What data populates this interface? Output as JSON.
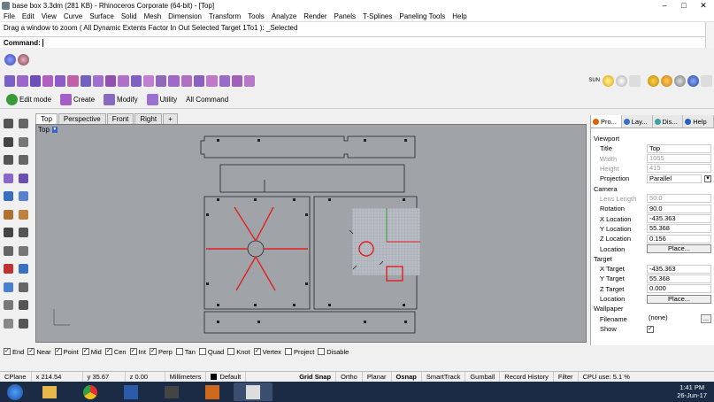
{
  "titlebar": {
    "title": "base box 3.3dm (281 KB) - Rhinoceros Corporate (64-bit) - [Top]",
    "min": "–",
    "max": "□",
    "close": "✕"
  },
  "menubar": [
    "File",
    "Edit",
    "View",
    "Curve",
    "Surface",
    "Solid",
    "Mesh",
    "Dimension",
    "Transform",
    "Tools",
    "Analyze",
    "Render",
    "Panels",
    "T-Splines",
    "Paneling Tools",
    "Help"
  ],
  "command": {
    "history": "Drag a window to zoom ( All  Dynamic  Extents  Factor  In  Out  Selected  Target  1To1 ): _Selected",
    "prompt": "Command:"
  },
  "toolbar_tabs": {
    "edit_mode": "Edit mode",
    "create": "Create",
    "modify": "Modify",
    "utility": "Utility",
    "all_command": "All Command"
  },
  "sun_label": "SUN",
  "viewport_tabs": [
    "Top",
    "Perspective",
    "Front",
    "Right"
  ],
  "viewport_add": "+",
  "viewport": {
    "label": "Top",
    "dropdown": "▼"
  },
  "osnaps": [
    {
      "label": "End",
      "checked": true
    },
    {
      "label": "Near",
      "checked": true
    },
    {
      "label": "Point",
      "checked": true
    },
    {
      "label": "Mid",
      "checked": true
    },
    {
      "label": "Cen",
      "checked": true
    },
    {
      "label": "Int",
      "checked": true
    },
    {
      "label": "Perp",
      "checked": true
    },
    {
      "label": "Tan",
      "checked": false
    },
    {
      "label": "Quad",
      "checked": false
    },
    {
      "label": "Knot",
      "checked": false
    },
    {
      "label": "Vertex",
      "checked": true
    },
    {
      "label": "Project",
      "checked": false
    },
    {
      "label": "Disable",
      "checked": false
    }
  ],
  "status": {
    "cplane": "CPlane",
    "x": "x 214.54",
    "y": "y 35.67",
    "z": "z 0.00",
    "units": "Millimeters",
    "layer": "Default",
    "grid_snap": "Grid Snap",
    "ortho": "Ortho",
    "planar": "Planar",
    "osnap": "Osnap",
    "smarttrack": "SmartTrack",
    "gumball": "Gumball",
    "record_history": "Record History",
    "filter": "Filter",
    "cpu": "CPU use: 5.1 %"
  },
  "panel": {
    "tabs": [
      "Pro...",
      "Lay...",
      "Dis...",
      "Help"
    ],
    "sections": {
      "viewport": {
        "heading": "Viewport",
        "rows": [
          {
            "k": "Title",
            "v": "Top",
            "dis": false
          },
          {
            "k": "Width",
            "v": "1055",
            "dis": true
          },
          {
            "k": "Height",
            "v": "415",
            "dis": true
          },
          {
            "k": "Projection",
            "v": "Parallel",
            "dis": false
          }
        ]
      },
      "camera": {
        "heading": "Camera",
        "rows": [
          {
            "k": "Lens Length",
            "v": "50.0",
            "dis": true
          },
          {
            "k": "Rotation",
            "v": "90.0",
            "dis": false
          },
          {
            "k": "X Location",
            "v": "-435.363",
            "dis": false
          },
          {
            "k": "Y Location",
            "v": "55.368",
            "dis": false
          },
          {
            "k": "Z Location",
            "v": "0.156",
            "dis": false
          }
        ],
        "location_label": "Location",
        "place_btn": "Place..."
      },
      "target": {
        "heading": "Target",
        "rows": [
          {
            "k": "X Target",
            "v": "-435.363",
            "dis": false
          },
          {
            "k": "Y Target",
            "v": "55.368",
            "dis": false
          },
          {
            "k": "Z Target",
            "v": "0.000",
            "dis": false
          }
        ],
        "location_label": "Location",
        "place_btn": "Place..."
      },
      "wallpaper": {
        "heading": "Wallpaper",
        "filename_label": "Filename",
        "filename": "(none)",
        "filename_btn": "...",
        "show_label": "Show",
        "show_checked": "✓"
      }
    }
  },
  "clock": {
    "time": "1:41 PM",
    "date": "26-Jun-17"
  },
  "colors": {
    "taskbar": "#1b2b45",
    "viewport_bg": "#a0a4a8",
    "red_curve": "#e02020",
    "grid": "#b8bcc4"
  }
}
